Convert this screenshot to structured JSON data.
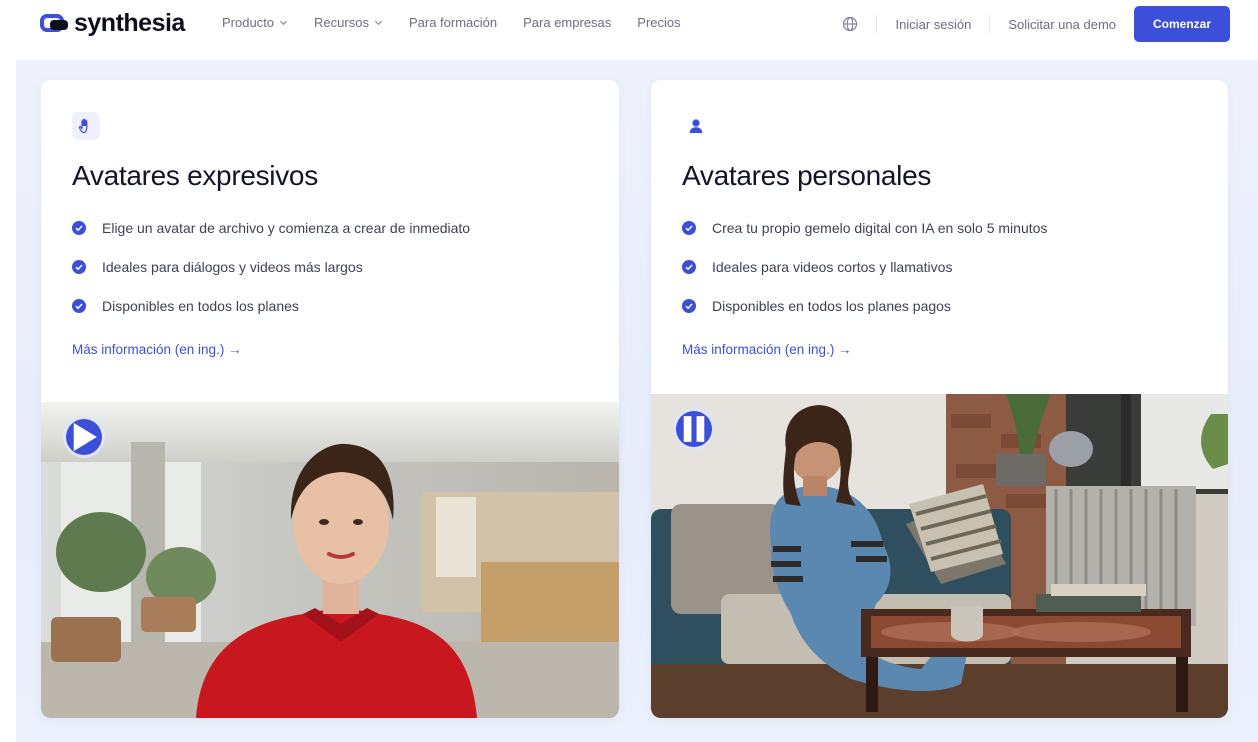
{
  "brand": {
    "name": "synthesia",
    "color": "#3b4fd8"
  },
  "nav": {
    "links": [
      {
        "label": "Producto",
        "dropdown": true
      },
      {
        "label": "Recursos",
        "dropdown": true
      },
      {
        "label": "Para formación",
        "dropdown": false
      },
      {
        "label": "Para empresas",
        "dropdown": false
      },
      {
        "label": "Precios",
        "dropdown": false
      }
    ],
    "language_icon": "globe-icon",
    "login": "Iniciar sesión",
    "demo": "Solicitar una demo",
    "cta": "Comenzar"
  },
  "cards": [
    {
      "icon": "hand-icon",
      "title": "Avatares expresivos",
      "bullets": [
        "Elige un avatar de archivo y comienza a crear de inmediato",
        "Ideales para diálogos y videos más largos",
        "Disponibles en todos los planes"
      ],
      "link": "Más información (en ing.) →",
      "media_control": "play-icon"
    },
    {
      "icon": "person-icon",
      "title": "Avatares personales",
      "bullets": [
        "Crea tu propio gemelo digital con IA en solo 5 minutos",
        "Ideales para videos cortos y llamativos",
        "Disponibles en todos los planes pagos"
      ],
      "link": "Más información (en ing.) →",
      "media_control": "pause-icon"
    }
  ]
}
